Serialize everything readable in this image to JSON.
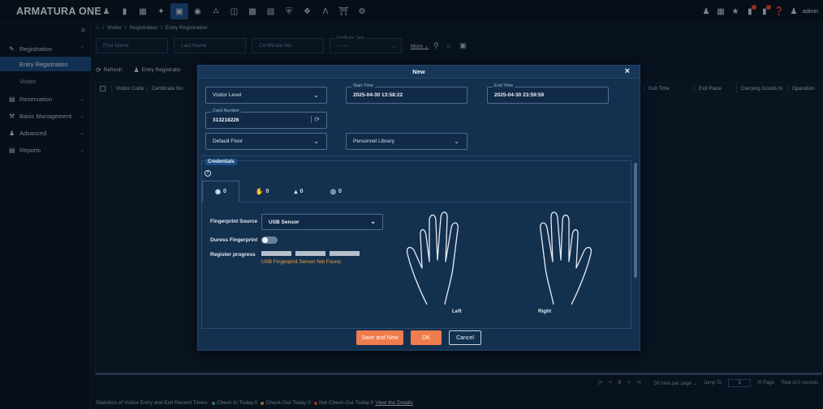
{
  "app": {
    "logo": "ARMATURA ONE",
    "user": "admin"
  },
  "topnav": {
    "icons": [
      "person-icon",
      "door-icon",
      "building-icon",
      "hub-icon",
      "card-icon",
      "location-icon",
      "car-icon",
      "train-icon",
      "elevator-icon",
      "parking-icon",
      "shield-icon",
      "alarm-icon",
      "letter-a-icon",
      "palace-icon",
      "gear-icon"
    ],
    "active_index": 4
  },
  "sidebar": {
    "items": [
      {
        "label": "Registration",
        "icon": "pen-icon"
      },
      {
        "label": "Reservation",
        "icon": "list-icon"
      },
      {
        "label": "Basic Management",
        "icon": "tools-icon"
      },
      {
        "label": "Advanced",
        "icon": "person-icon"
      },
      {
        "label": "Reports",
        "icon": "doc-icon"
      }
    ],
    "subitems": [
      {
        "label": "Entry Registration"
      },
      {
        "label": "Visitor"
      }
    ]
  },
  "breadcrumb": [
    "Visitor",
    "Registration",
    "Entry Registration"
  ],
  "filters": {
    "first_name_placeholder": "First Name",
    "last_name_placeholder": "Last Name",
    "cert_no_placeholder": "Certificate No.",
    "cert_type_label": "Certificate Type",
    "cert_type_value": "-------",
    "more_label": "More"
  },
  "toolbar": {
    "refresh_label": "Refresh",
    "entry_reg_label": "Entry Registratio"
  },
  "grid": {
    "columns_left": [
      "Visitor Code",
      "Certificate No."
    ],
    "columns_right": [
      "Exit Time",
      "Exit Place",
      "Carrying Goods In",
      "Operation"
    ]
  },
  "pager": {
    "page": "0",
    "rows_per_page": "50 rows per page",
    "jump_to": "Jump To",
    "jump_value": "1",
    "pages": "/0 Page",
    "total": "Total of 0 records"
  },
  "stats": {
    "prefix": "Statistics of Visitor Entry and Exit Record Times:",
    "check_in": "Check-In Today:0",
    "check_out": "Check-Out Today:0",
    "not_check_out": "Not Check-Out Today:0",
    "link": "View the Details",
    "colors": {
      "check_in": "#3fbf6a",
      "check_out": "#f2a531",
      "not_check_out": "#e04a3a"
    }
  },
  "modal": {
    "title": "New",
    "visitor_level": "Visitor Level",
    "start_time_label": "Start Time",
    "start_time": "2025-04-30 13:58:22",
    "end_time_label": "End Time",
    "end_time": "2025-04-30 23:59:59",
    "card_number_label": "Card Number",
    "card_number": "313218226",
    "default_floor": "Default Floor",
    "personnel_library": "Personnel Library",
    "credentials_label": "Credentials",
    "cred_tabs": [
      {
        "icon": "face-icon",
        "count": "0"
      },
      {
        "icon": "palm-icon",
        "count": "0"
      },
      {
        "icon": "fingerprint-icon",
        "count": "0"
      },
      {
        "icon": "iris-icon",
        "count": "0"
      }
    ],
    "fp_source_label": "Fingerprint Source",
    "fp_source_value": "USB Sensor",
    "duress_label": "Duress Fingerprint",
    "duress_on": false,
    "register_label": "Register progress",
    "progress_segments": 3,
    "error": "USB Fingerprint Sensor Not Found.",
    "left_hand": "Left",
    "right_hand": "Right",
    "save_new": "Save and New",
    "ok": "OK",
    "cancel": "Cancel"
  }
}
